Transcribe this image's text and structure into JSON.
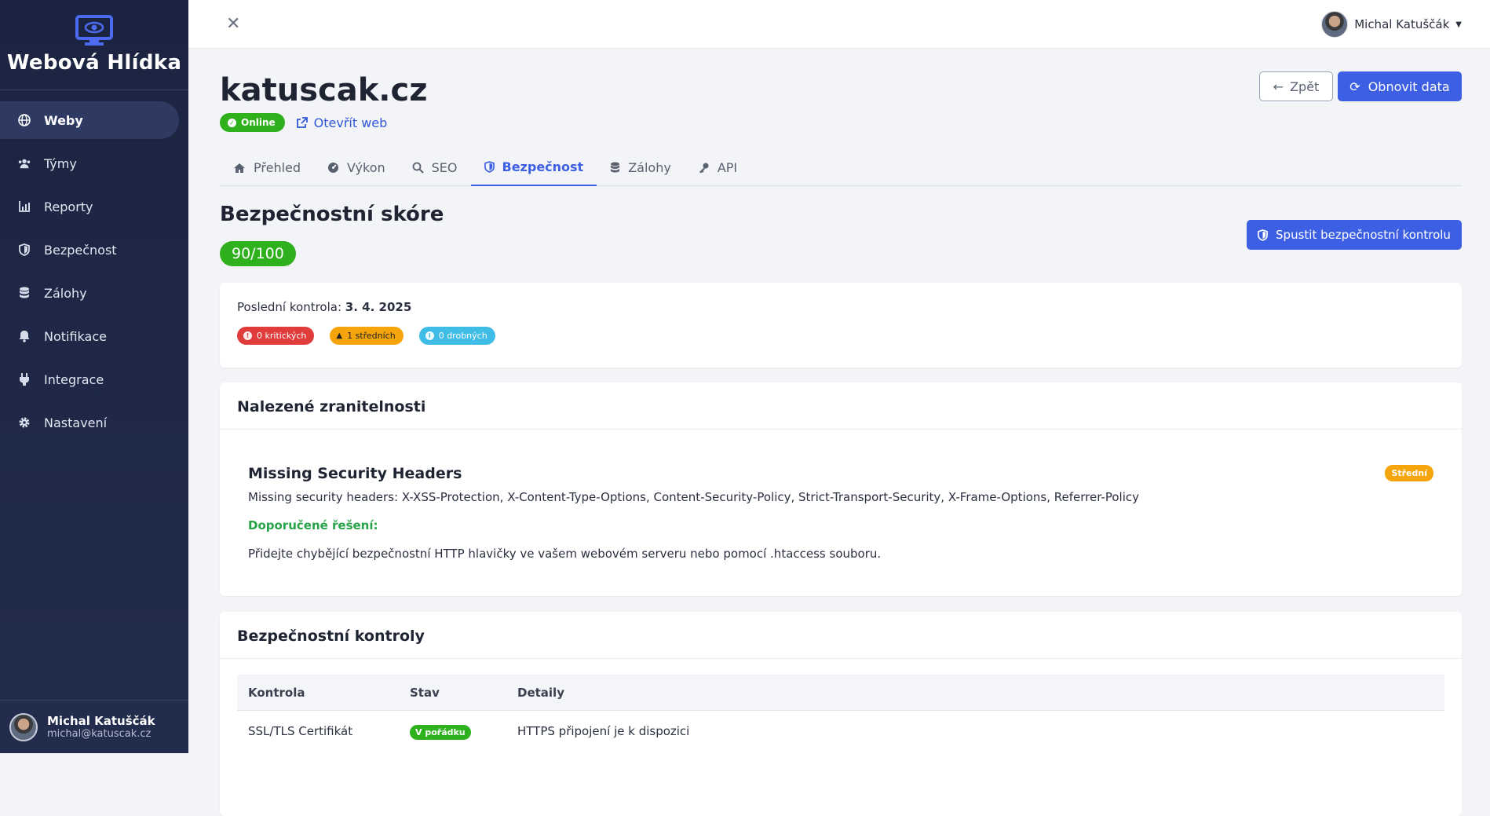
{
  "app": {
    "name": "Webová Hlídka"
  },
  "sidebar": {
    "items": [
      {
        "label": "Weby",
        "icon": "globe-icon",
        "active": true
      },
      {
        "label": "Týmy",
        "icon": "users-icon"
      },
      {
        "label": "Reporty",
        "icon": "chart-icon"
      },
      {
        "label": "Bezpečnost",
        "icon": "shield-icon"
      },
      {
        "label": "Zálohy",
        "icon": "database-icon"
      },
      {
        "label": "Notifikace",
        "icon": "bell-icon"
      },
      {
        "label": "Integrace",
        "icon": "plug-icon"
      },
      {
        "label": "Nastavení",
        "icon": "gear-icon"
      }
    ],
    "user": {
      "name": "Michal Katuščák",
      "email": "michal@katuscak.cz"
    }
  },
  "topbar": {
    "user_name": "Michal Katuščák"
  },
  "site": {
    "title": "katuscak.cz",
    "status": "Online",
    "open_link": "Otevřít web"
  },
  "actions": {
    "back": "Zpět",
    "refresh": "Obnovit data",
    "scan": "Spustit bezpečnostní kontrolu"
  },
  "tabs": [
    {
      "label": "Přehled",
      "icon": "home-icon"
    },
    {
      "label": "Výkon",
      "icon": "gauge-icon"
    },
    {
      "label": "SEO",
      "icon": "search-icon"
    },
    {
      "label": "Bezpečnost",
      "icon": "shield-icon",
      "active": true
    },
    {
      "label": "Zálohy",
      "icon": "database-icon"
    },
    {
      "label": "API",
      "icon": "key-icon"
    }
  ],
  "security": {
    "title": "Bezpečnostní skóre",
    "score": "90/100",
    "last_check_label": "Poslední kontrola:",
    "last_check_date": "3. 4. 2025",
    "badges": {
      "critical": "0 kritických",
      "medium": "1 středních",
      "minor": "0 drobných"
    },
    "colors": {
      "critical": "#e03c3c",
      "medium": "#f5a50b",
      "minor": "#40bde6",
      "ok": "#2fb01d",
      "accent": "#3c5fe3"
    }
  },
  "vulns": {
    "title": "Nalezené zranitelnosti",
    "items": [
      {
        "title": "Missing Security Headers",
        "severity": "Střední",
        "description": "Missing security headers: X-XSS-Protection, X-Content-Type-Options, Content-Security-Policy, Strict-Transport-Security, X-Frame-Options, Referrer-Policy",
        "recommend_label": "Doporučené řešení:",
        "recommendation": "Přidejte chybějící bezpečnostní HTTP hlavičky ve vašem webovém serveru nebo pomocí .htaccess souboru."
      }
    ]
  },
  "checks": {
    "title": "Bezpečnostní kontroly",
    "columns": [
      "Kontrola",
      "Stav",
      "Detaily"
    ],
    "rows": [
      {
        "name": "SSL/TLS Certifikát",
        "status": "V pořádku",
        "details": "HTTPS připojení je k dispozici"
      }
    ]
  }
}
